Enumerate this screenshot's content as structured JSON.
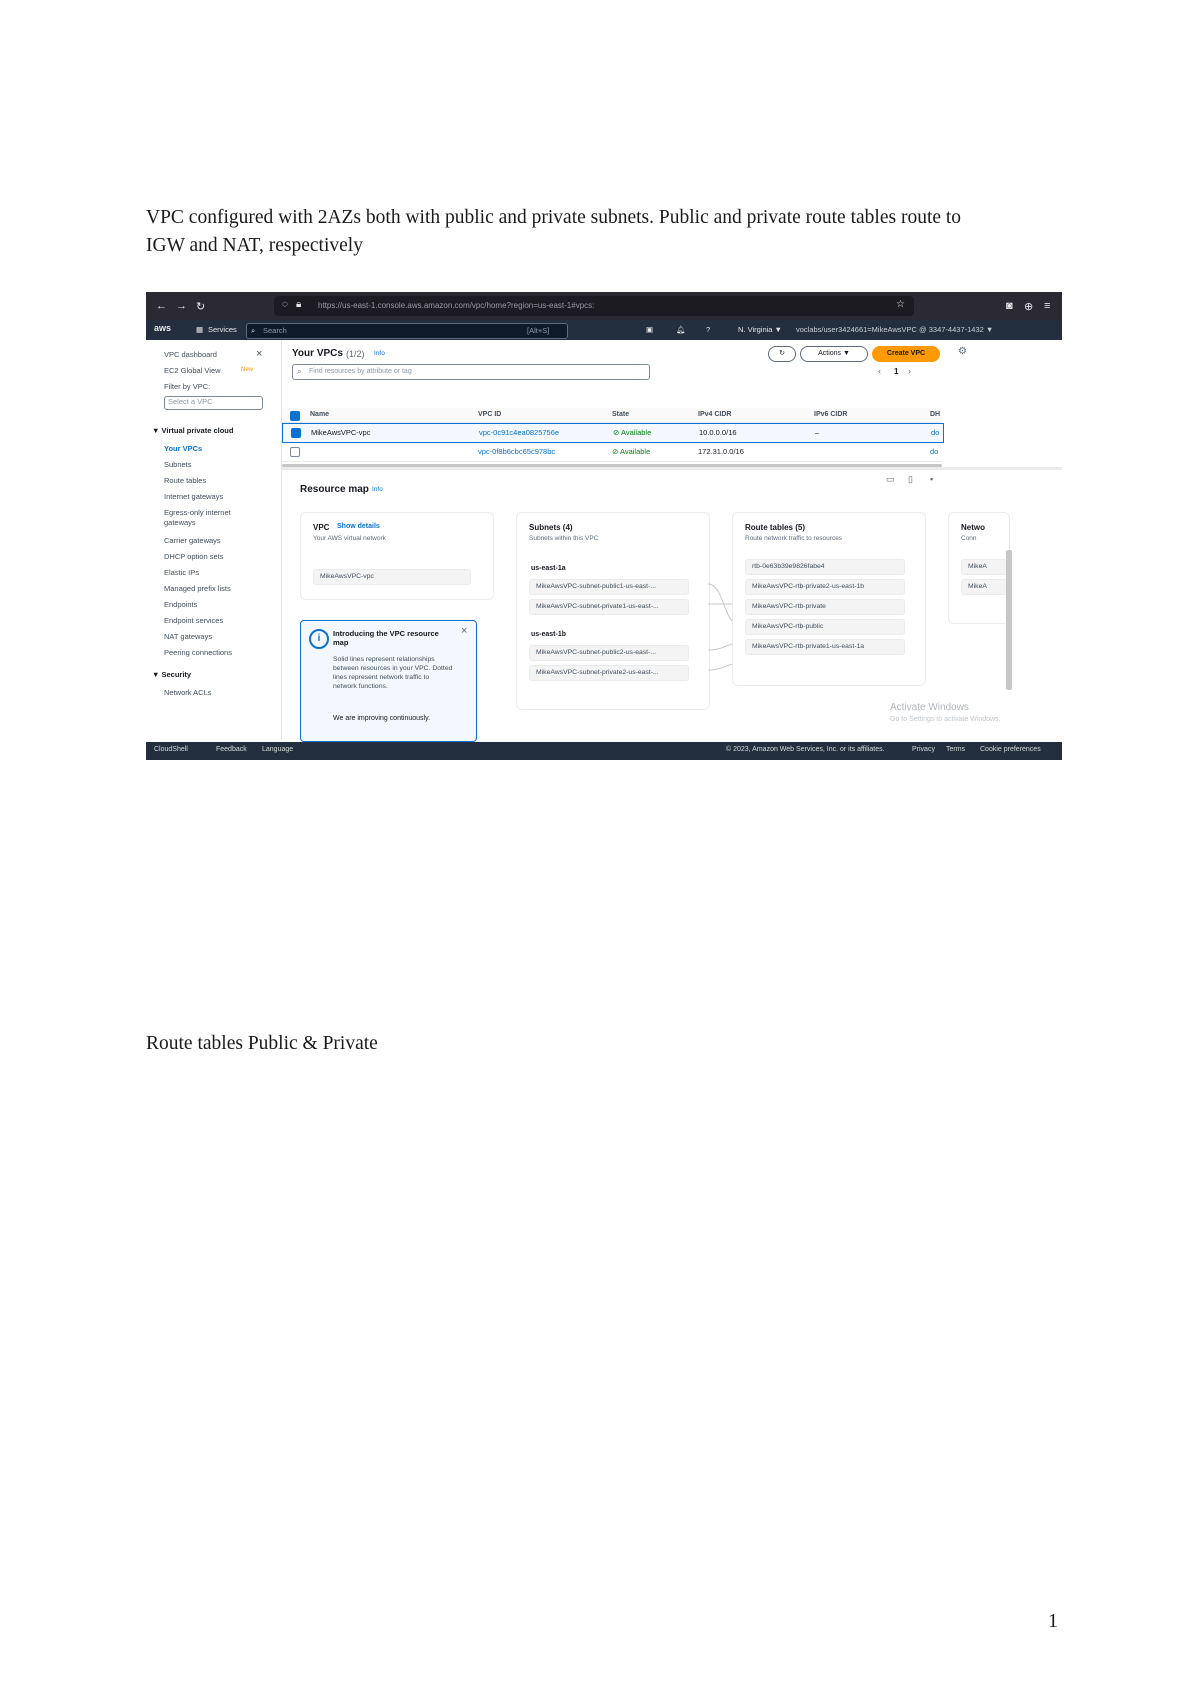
{
  "doc": {
    "paragraph1": "VPC configured with 2AZs both with public and private subnets. Public and private route tables route to IGW and NAT, respectively",
    "paragraph2": "Route tables Public & Private",
    "page_number": "1"
  },
  "screenshot": {
    "url": "https://us-east-1.console.aws.amazon.com/vpc/home?region=us-east-1#vpcs:",
    "aws_bar": {
      "logo": "aws",
      "services": "Services",
      "search_placeholder": "Search",
      "shortcut": "[Alt+S]",
      "region": "N. Virginia ▼",
      "account": "voclabs/user3424661=MikeAwsVPC @ 3347-4437-1432 ▼"
    },
    "sidebar": {
      "items": [
        "VPC dashboard",
        "EC2 Global View",
        "Filter by VPC:",
        "Select a VPC",
        "▼ Virtual private cloud",
        "Your VPCs",
        "Subnets",
        "Route tables",
        "Internet gateways",
        "Egress-only internet",
        "gateways",
        "Carrier gateways",
        "DHCP option sets",
        "Elastic IPs",
        "Managed prefix lists",
        "Endpoints",
        "Endpoint services",
        "NAT gateways",
        "Peering connections",
        "▼ Security",
        "Network ACLs"
      ],
      "new_badge": "New"
    },
    "vpcs": {
      "title": "Your VPCs",
      "count": "(1/2)",
      "info": "Info",
      "filter_placeholder": "Find resources by attribute or tag",
      "actions": "Actions ▼",
      "create": "Create VPC",
      "page": "1",
      "columns": [
        "Name",
        "VPC ID",
        "State",
        "IPv4 CIDR",
        "IPv6 CIDR",
        "DH"
      ],
      "rows": [
        {
          "name": "MikeAwsVPC-vpc",
          "id": "vpc-0c91c4ea0825756e",
          "state": "⊘ Available",
          "ipv4": "10.0.0.0/16",
          "ipv6": "–",
          "dh": "do",
          "selected": true
        },
        {
          "name": "",
          "id": "vpc-0f8b6cbc65c978bc",
          "state": "⊘ Available",
          "ipv4": "172.31.0.0/16",
          "ipv6": "",
          "dh": "do",
          "selected": false
        }
      ]
    },
    "resource_map": {
      "title": "Resource map",
      "info": "Info",
      "vpc_card": {
        "title": "VPC",
        "link": "Show details",
        "sub": "Your AWS virtual network",
        "item": "MikeAwsVPC-vpc"
      },
      "subnets_card": {
        "title": "Subnets (4)",
        "sub": "Subnets within this VPC",
        "az1": "us-east-1a",
        "az1_items": [
          "MikeAwsVPC-subnet-public1-us-east-...",
          "MikeAwsVPC-subnet-private1-us-east-..."
        ],
        "az2": "us-east-1b",
        "az2_items": [
          "MikeAwsVPC-subnet-public2-us-east-...",
          "MikeAwsVPC-subnet-private2-us-east-..."
        ]
      },
      "routes_card": {
        "title": "Route tables (5)",
        "sub": "Route network traffic to resources",
        "items": [
          "rtb-0e63b39e9826fabe4",
          "MikeAwsVPC-rtb-private2-us-east-1b",
          "MikeAwsVPC-rtb-private",
          "MikeAwsVPC-rtb-public",
          "MikeAwsVPC-rtb-private1-us-east-1a"
        ]
      },
      "network_card": {
        "title": "Netwo",
        "sub": "Conn",
        "items": [
          "MikeA",
          "MikeA"
        ]
      },
      "info_box": {
        "title": "Introducing the VPC resource map",
        "body": "Solid lines represent relationships between resources in your VPC. Dotted lines represent network traffic to network functions.",
        "note": "We are improving continuously."
      }
    },
    "footer": {
      "cloudshell": "CloudShell",
      "feedback": "Feedback",
      "language": "Language",
      "copyright": "© 2023, Amazon Web Services, Inc. or its affiliates.",
      "privacy": "Privacy",
      "terms": "Terms",
      "cookies": "Cookie preferences"
    },
    "watermark": {
      "line1": "Activate Windows",
      "line2": "Go to Settings to activate Windows."
    }
  }
}
